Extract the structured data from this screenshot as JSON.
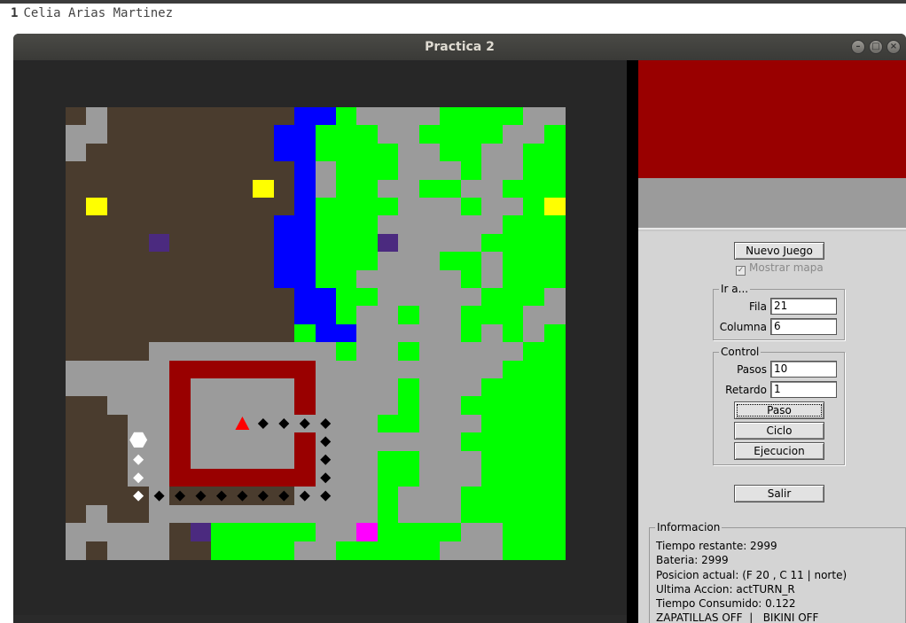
{
  "editor": {
    "line_number": "1",
    "text": "Celia Arias Martinez"
  },
  "window": {
    "title": "Practica 2"
  },
  "controls": {
    "nuevo_juego": "Nuevo Juego",
    "mostrar_mapa": "Mostrar mapa",
    "mostrar_mapa_checked": true,
    "ir_a": {
      "title": "Ir a...",
      "fila_label": "Fila",
      "fila_value": "21",
      "columna_label": "Columna",
      "columna_value": "6"
    },
    "control": {
      "title": "Control",
      "pasos_label": "Pasos",
      "pasos_value": "10",
      "retardo_label": "Retardo",
      "retardo_value": "1",
      "paso": "Paso",
      "ciclo": "Ciclo",
      "ejecucion": "Ejecucion"
    },
    "salir": "Salir"
  },
  "info": {
    "title": "Informacion",
    "lines": [
      "Tiempo restante: 2999",
      "Bateria: 2999",
      "Posicion actual: (F 20 , C 11 | norte)",
      "Ultima Accion: actTURN_R",
      "Tiempo Consumido: 0.122",
      "ZAPATILLAS OFF  |   BIKINI OFF"
    ]
  },
  "map": {
    "colors": {
      "B": "#4a3c2e",
      "G": "#9b9b9b",
      "W": "#0000ff",
      "V": "#00ff00",
      "R": "#990000",
      "Y": "#ffff00",
      "P": "#4b2a7f",
      "M": "#ff00ff",
      "A": "#ff0000"
    },
    "grid": [
      "BGBBBBBBBBBWWVGGGGVVVVGG",
      "GGBBBBBBBBWWVVVGGVVVVGGV",
      "GBBBBBBBBBWWVVVVGGVVGGVV",
      "BBBBBBBBBBBWGVVVGGGVGGVV",
      "BBBBBBBBBWBWGVVGGVVGGVVV",
      "BYBBBBBBBBBWVVVVGGGVGGVY",
      "BBBBBBBBBBWWVVVGGGGGGVVV",
      "BBBBBBBBBBWWVVVPGGGGVVVV",
      "BBBBBBBBBBWWVVVGGGVVGVVV",
      "BBBBBBBBBBWWVVGGGGGVGVVV",
      "BBBBBBBBBBBWWVVGGGGGVVVG",
      "BBBBBBBBBBBWWVGGVGGVVVGG",
      "BBBBBBBBBBBVWWGGGGGVGVGV",
      "BBBBBBBBBBBGGGGGVGGGGGVV",
      "BBBBBBBBBBBGGGGGGGGGGVVV",
      "GGGBBBBBBBBGGGGGVGGGVVVV",
      "BBGBBBBBBBBGGGGGVGGVVVVV",
      "BBBBBBBBBBBGGGGVVGGGVVVV",
      "BBBBBBBBBBBGGGGGGGGVVVVV",
      "BBBBBBBBBBBGGGGVVGGGVVVV",
      "BBBBBBBBBBBGGGGVVGGGVVVV",
      "BBBBBBBBBBBGGGGVGGGVVVVV",
      "BBBBBBBBBBBGGGGVGGGVVVVV",
      "GGGGBBBBBBGGGGGVGGGVVVVV",
      "GBGGGBBBBBGGGGGVGGGGGVVV"
    ],
    "overrides": [
      [
        "B",
        12,
        2
      ],
      [
        "B",
        13,
        2
      ],
      [
        "Y",
        5,
        1
      ],
      [
        "Y",
        4,
        9
      ],
      [
        "Y",
        5,
        23
      ],
      [
        "P",
        7,
        4
      ],
      [
        "P",
        7,
        15
      ],
      [
        "P",
        23,
        6
      ],
      [
        "M",
        23,
        14
      ],
      [
        "G",
        13,
        4
      ],
      [
        "G",
        13,
        5
      ],
      [
        "G",
        13,
        6
      ],
      [
        "G",
        13,
        7
      ],
      [
        "G",
        13,
        8
      ],
      [
        "G",
        13,
        9
      ],
      [
        "G",
        13,
        10
      ],
      [
        "G",
        13,
        11
      ],
      [
        "G",
        13,
        12
      ],
      [
        "G",
        13,
        13
      ],
      [
        "G",
        14,
        0
      ],
      [
        "G",
        14,
        1
      ],
      [
        "G",
        14,
        2
      ],
      [
        "G",
        14,
        3
      ],
      [
        "G",
        14,
        4
      ],
      [
        "G",
        15,
        0
      ],
      [
        "G",
        15,
        1
      ],
      [
        "G",
        15,
        3
      ],
      [
        "G",
        15,
        4
      ],
      [
        "G",
        16,
        3
      ],
      [
        "G",
        16,
        4
      ],
      [
        "G",
        17,
        3
      ],
      [
        "G",
        17,
        4
      ],
      [
        "G",
        18,
        3
      ],
      [
        "G",
        18,
        4
      ],
      [
        "G",
        19,
        3
      ],
      [
        "G",
        19,
        4
      ],
      [
        "G",
        20,
        3
      ],
      [
        "G",
        20,
        4
      ],
      [
        "G",
        21,
        4
      ],
      [
        "G",
        22,
        4
      ],
      [
        "G",
        22,
        1
      ],
      [
        "G",
        23,
        0
      ],
      [
        "G",
        23,
        1
      ],
      [
        "G",
        23,
        2
      ],
      [
        "G",
        23,
        3
      ],
      [
        "G",
        23,
        4
      ],
      [
        "G",
        23,
        5
      ],
      [
        "G",
        24,
        0
      ],
      [
        "G",
        24,
        2
      ],
      [
        "G",
        24,
        3
      ],
      [
        "G",
        24,
        4
      ],
      [
        "G",
        22,
        5
      ],
      [
        "G",
        22,
        6
      ],
      [
        "G",
        22,
        7
      ],
      [
        "G",
        22,
        8
      ],
      [
        "G",
        22,
        9
      ],
      [
        "G",
        22,
        10
      ],
      [
        "G",
        22,
        11
      ],
      [
        "G",
        22,
        12
      ],
      [
        "G",
        22,
        13
      ],
      [
        "G",
        22,
        14
      ],
      [
        "B",
        22,
        0
      ],
      [
        "B",
        21,
        0
      ],
      [
        "B",
        20,
        0
      ],
      [
        "B",
        19,
        0
      ],
      [
        "B",
        18,
        0
      ],
      [
        "B",
        17,
        0
      ],
      [
        "B",
        16,
        0
      ],
      [
        "B",
        24,
        1
      ],
      [
        "V",
        23,
        7
      ],
      [
        "V",
        23,
        8
      ],
      [
        "V",
        23,
        9
      ],
      [
        "V",
        23,
        10
      ],
      [
        "V",
        23,
        11
      ],
      [
        "V",
        24,
        7
      ],
      [
        "V",
        24,
        8
      ],
      [
        "V",
        24,
        9
      ],
      [
        "V",
        24,
        10
      ],
      [
        "B",
        23,
        5
      ],
      [
        "B",
        24,
        5
      ],
      [
        "B",
        24,
        6
      ],
      [
        "G",
        24,
        11
      ],
      [
        "G",
        24,
        12
      ],
      [
        "G",
        23,
        12
      ],
      [
        "G",
        23,
        13
      ],
      [
        "V",
        24,
        13
      ],
      [
        "V",
        24,
        14
      ],
      [
        "V",
        24,
        15
      ],
      [
        "V",
        24,
        16
      ],
      [
        "V",
        24,
        17
      ],
      [
        "V",
        23,
        15
      ],
      [
        "V",
        23,
        16
      ],
      [
        "G",
        24,
        18
      ],
      [
        "G",
        24,
        19
      ],
      [
        "G",
        24,
        20
      ],
      [
        "V",
        24,
        21
      ],
      [
        "V",
        24,
        22
      ],
      [
        "V",
        24,
        23
      ],
      [
        "V",
        23,
        17
      ],
      [
        "V",
        23,
        18
      ],
      [
        "G",
        23,
        19
      ],
      [
        "G",
        23,
        20
      ],
      [
        "V",
        23,
        21
      ],
      [
        "V",
        23,
        22
      ],
      [
        "V",
        23,
        23
      ],
      [
        "G",
        12,
        11
      ],
      [
        "G",
        12,
        12
      ],
      [
        "G",
        12,
        13
      ],
      [
        "V",
        12,
        11
      ],
      [
        "W",
        12,
        12
      ],
      [
        "W",
        12,
        13
      ],
      [
        "G",
        13,
        11
      ],
      [
        "V",
        13,
        13
      ]
    ],
    "walls": [
      [
        14,
        5
      ],
      [
        14,
        6
      ],
      [
        14,
        7
      ],
      [
        14,
        8
      ],
      [
        14,
        9
      ],
      [
        14,
        10
      ],
      [
        14,
        11
      ],
      [
        15,
        5
      ],
      [
        16,
        5
      ],
      [
        17,
        5
      ],
      [
        18,
        5
      ],
      [
        19,
        5
      ],
      [
        15,
        11
      ],
      [
        16,
        11
      ],
      [
        18,
        11
      ],
      [
        19,
        11
      ],
      [
        20,
        5
      ],
      [
        20,
        6
      ],
      [
        20,
        7
      ],
      [
        20,
        8
      ],
      [
        20,
        9
      ],
      [
        20,
        10
      ],
      [
        20,
        11
      ]
    ],
    "agent": [
      17,
      8
    ],
    "path": [
      [
        17,
        9
      ],
      [
        17,
        10
      ],
      [
        17,
        11
      ],
      [
        17,
        12
      ],
      [
        18,
        12
      ],
      [
        19,
        12
      ],
      [
        20,
        12
      ],
      [
        21,
        12
      ],
      [
        21,
        11
      ],
      [
        21,
        10
      ],
      [
        21,
        9
      ],
      [
        21,
        8
      ],
      [
        21,
        7
      ],
      [
        21,
        6
      ],
      [
        21,
        5
      ],
      [
        21,
        4
      ],
      [
        21,
        3
      ],
      [
        20,
        3
      ],
      [
        19,
        3
      ]
    ],
    "white_path": [
      [
        18,
        3
      ],
      [
        19,
        3
      ],
      [
        20,
        3
      ],
      [
        21,
        3
      ]
    ]
  }
}
